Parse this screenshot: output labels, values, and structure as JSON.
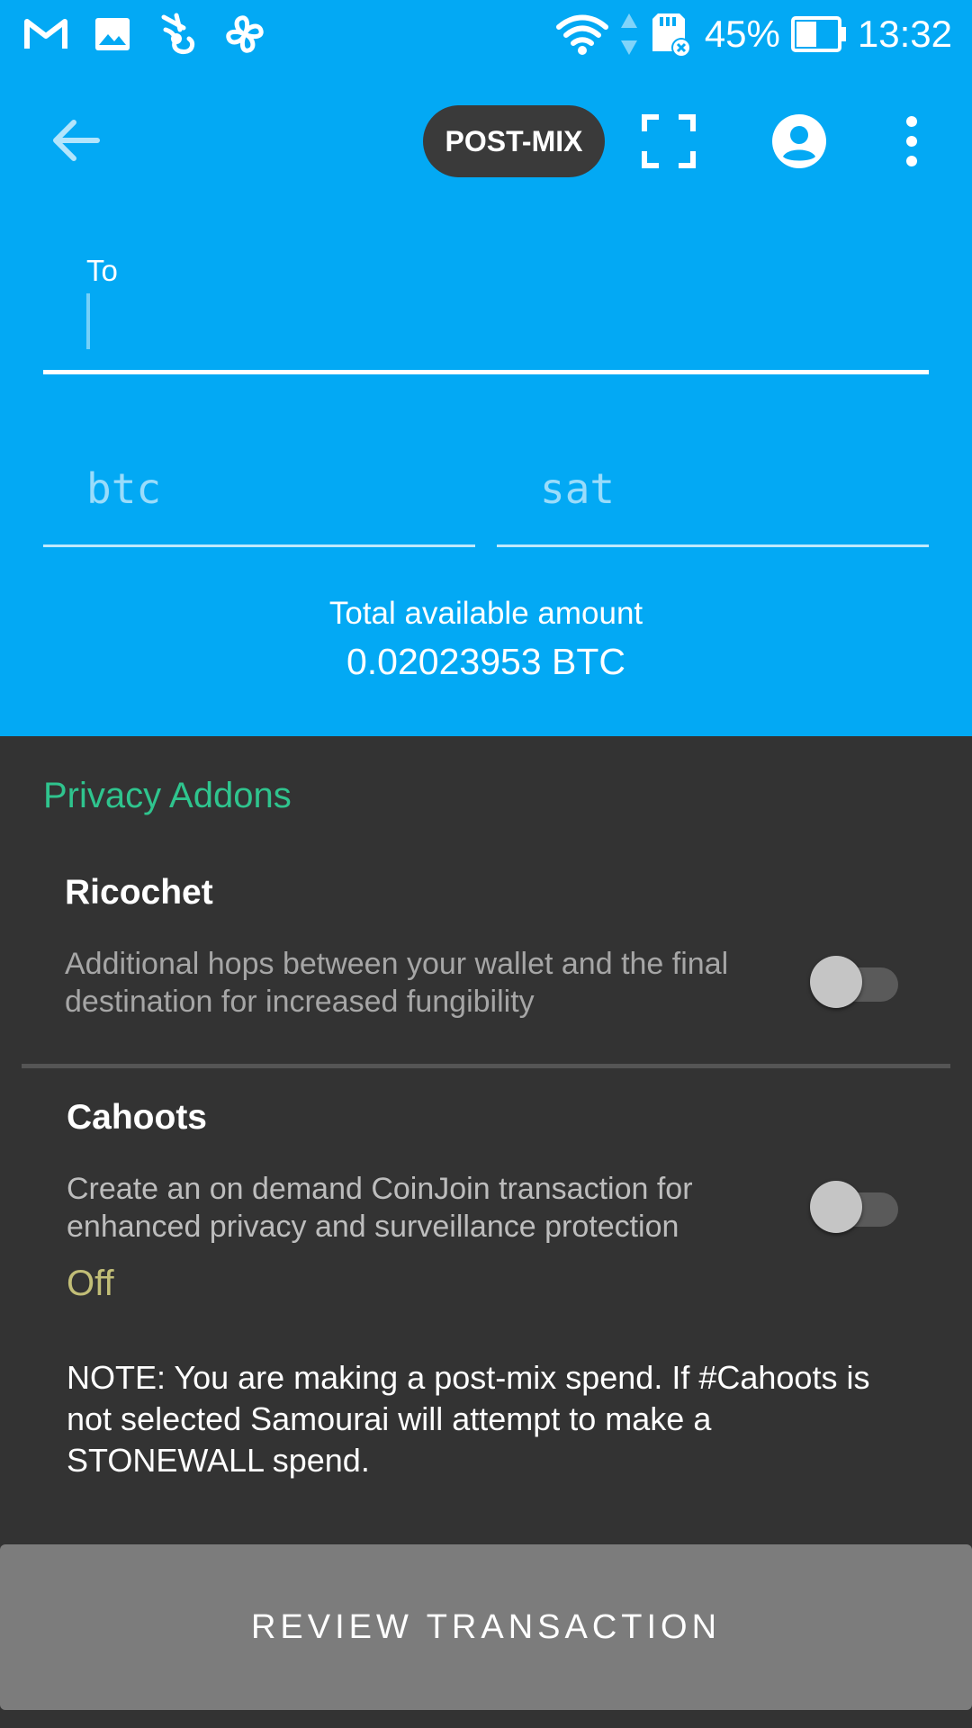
{
  "status_bar": {
    "battery_percent": "45%",
    "time": "13:32",
    "left_icons": [
      "gmail-icon",
      "gallery-icon",
      "samourai-icon",
      "fan-icon"
    ],
    "right_icons": [
      "wifi-icon",
      "data-arrows-icon",
      "sd-card-icon",
      "battery-icon"
    ]
  },
  "toolbar": {
    "back_icon": "arrow-left-icon",
    "mode_badge": "POST-MIX",
    "scan_icon": "scan-frame-icon",
    "account_icon": "account-circle-icon",
    "more_icon": "more-vertical-icon"
  },
  "form": {
    "to_label": "To",
    "to_value": "",
    "btc_placeholder": "btc",
    "sat_placeholder": "sat",
    "total_label": "Total available amount",
    "total_value": "0.02023953 BTC"
  },
  "privacy": {
    "section_title": "Privacy Addons",
    "ricochet": {
      "title": "Ricochet",
      "description": "Additional hops between your wallet and the final destination for increased fungibility",
      "enabled": false
    },
    "cahoots": {
      "title": "Cahoots",
      "description": "Create an on demand CoinJoin transaction for enhanced privacy and surveillance protection",
      "enabled": false,
      "status": "Off"
    },
    "note": "NOTE: You are making a post-mix spend. If #Cahoots is not selected Samourai will attempt to make a STONEWALL spend."
  },
  "actions": {
    "review_label": "REVIEW TRANSACTION"
  },
  "colors": {
    "primary_blue": "#03A9F4",
    "dark_background": "#333333",
    "accent_green": "#2FC48E",
    "off_status": "#C2BE77",
    "review_button": "#7C7C7C"
  }
}
